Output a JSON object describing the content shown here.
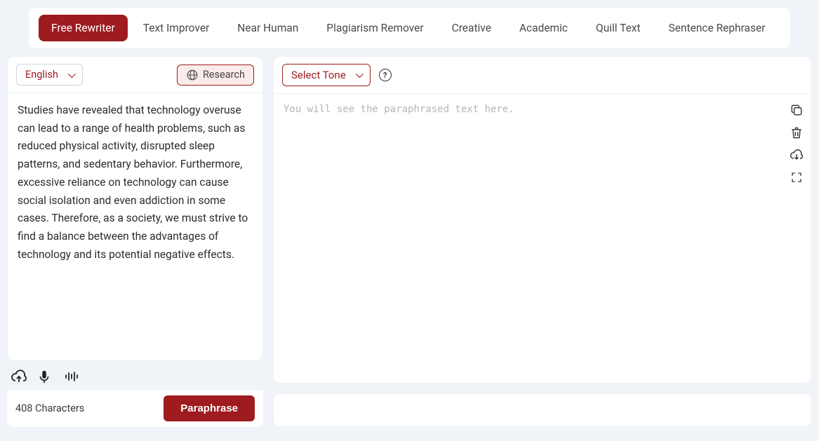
{
  "tabs": [
    {
      "label": "Free Rewriter",
      "active": true
    },
    {
      "label": "Text Improver"
    },
    {
      "label": "Near Human"
    },
    {
      "label": "Plagiarism Remover"
    },
    {
      "label": "Creative"
    },
    {
      "label": "Academic"
    },
    {
      "label": "Quill Text"
    },
    {
      "label": "Sentence Rephraser"
    }
  ],
  "left": {
    "language": "English",
    "research_label": "Research",
    "input_text": "Studies have revealed that technology overuse can lead to a range of health problems, such as reduced physical activity, disrupted sleep patterns, and sedentary behavior. Furthermore, excessive reliance on technology can cause social isolation and even addiction in some cases. Therefore, as a society, we must strive to find a balance between the advantages of technology and its potential negative effects.",
    "char_count": "408 Characters",
    "paraphrase_label": "Paraphrase"
  },
  "right": {
    "tone_label": "Select Tone",
    "placeholder": "You will see the paraphrased text here."
  }
}
